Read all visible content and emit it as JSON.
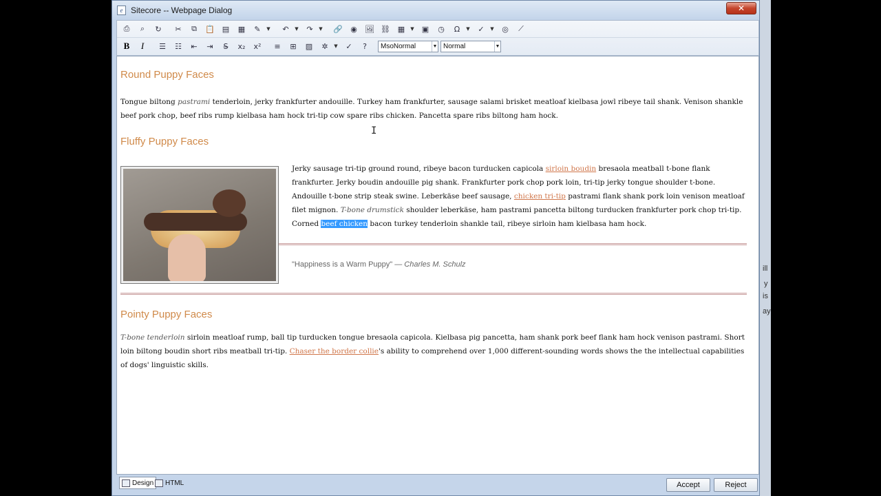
{
  "window": {
    "title": "Sitecore -- Webpage Dialog",
    "close_label": "✕"
  },
  "toolbar": {
    "style_select": "MsoNormal",
    "format_select": "Normal",
    "bold_label": "B",
    "italic_label": "I"
  },
  "document": {
    "section1": {
      "heading": "Round Puppy Faces",
      "text_a": "Tongue biltong ",
      "em": "pastrami",
      "text_b": " tenderloin, jerky frankfurter andouille. Turkey ham frankfurter, sausage salami brisket meatloaf kielbasa jowl ribeye tail shank. Venison shankle beef pork chop, beef ribs rump kielbasa ham hock tri-tip cow spare ribs chicken. Pancetta spare ribs biltong ham hock."
    },
    "section2": {
      "heading": "Fluffy Puppy Faces",
      "text_a": "Jerky sausage tri-tip ground round, ribeye bacon turducken capicola ",
      "link1": "sirloin boudin",
      "text_b": " bresaola meatball t-bone flank frankfurter. Jerky boudin andouille pig shank. Frankfurter pork chop pork loin, tri-tip jerky tongue shoulder t-bone. Andouille t-bone strip steak swine. Leberkäse beef sausage, ",
      "link2": "chicken tri-tip",
      "text_c": " pastrami flank shank pork loin venison meatloaf filet mignon. ",
      "em": "T-bone drumstick",
      "text_d": " shoulder leberkäse, ham pastrami pancetta biltong turducken frankfurter pork chop tri-tip. Corned ",
      "selected": "beef chicken",
      "text_e": " bacon turkey tenderloin shankle tail, ribeye sirloin ham kielbasa ham hock.",
      "quote_text": "\"Happiness is a Warm Puppy\" — ",
      "quote_author": "Charles M. Schulz"
    },
    "section3": {
      "heading": "Pointy Puppy Faces",
      "em": "T-bone tenderloin",
      "text_a": " sirloin meatloaf rump, ball tip turducken tongue bresaola capicola. Kielbasa pig pancetta, ham shank pork beef flank ham hock venison pastrami. Short loin biltong boudin short ribs meatball tri-tip. ",
      "link": "Chaser the border collie",
      "text_b": "'s ability to comprehend over 1,000 different-sounding words shows the the intellectual capabilities of dogs' linguistic skills."
    }
  },
  "bottom": {
    "design_tab": "Design",
    "html_tab": "HTML",
    "accept_label": "Accept",
    "reject_label": "Reject"
  },
  "background_window": {
    "fragment1": "ill",
    "fragment2": "y",
    "fragment3": "is",
    "fragment4": "ay"
  }
}
